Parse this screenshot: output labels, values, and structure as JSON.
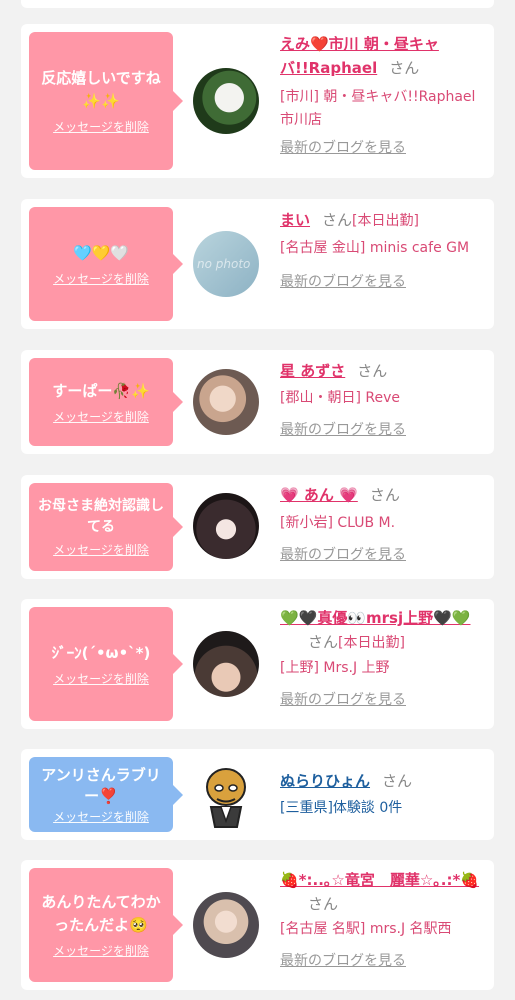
{
  "del_label": "メッセージを削除",
  "blog_label": "最新のブログを見る",
  "san": "さん",
  "cards": [
    {
      "message": "反応嬉しいですね✨✨",
      "name": "えみ❤️市川 朝・昼キャバ!!Raphael",
      "location": "[市川] 朝・昼キャバ!!Raphael 市川店"
    },
    {
      "message": "🩵💛🤍",
      "name": "まい",
      "status": "[本日出勤]",
      "location": "[名古屋 金山] minis cafe GM",
      "avatar_text": "no photo"
    },
    {
      "message": "すーぱー🥀✨",
      "name": "星 あずさ",
      "location": "[郡山・朝日] Reve"
    },
    {
      "message": "お母さま絶対認識してる",
      "name": "💗 あん 💗",
      "location": "[新小岩] CLUB M."
    },
    {
      "message": "ｼﾞｰﾝ(´•ω•`*)",
      "name": "💚🖤真優👀mrsj上野🖤💚",
      "status": "[本日出勤]",
      "location": "[上野] Mrs.J 上野"
    },
    {
      "message": "アンリさんラブリー❣️",
      "name": "ぬらりひょん",
      "location": "[三重県]体験談 0件"
    },
    {
      "message": "あんりたんてわかったんだよ🥺",
      "name": "🍓*:..｡☆竜宮　麗華☆｡.:*🍓",
      "location": "[名古屋 名駅] mrs.J 名駅西"
    }
  ],
  "colors": {
    "pink_bubble": "#ff97a7",
    "blue_bubble": "#8ab9f1",
    "pink_text": "#e0336a",
    "blue_text": "#1e5f9e",
    "gray": "#999999"
  }
}
